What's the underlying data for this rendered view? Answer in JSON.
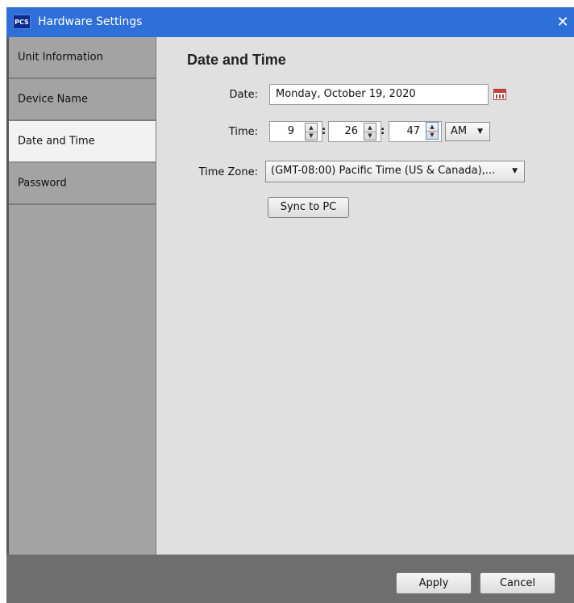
{
  "window": {
    "app_icon_text": "PCS",
    "title": "Hardware Settings",
    "close_glyph": "✕"
  },
  "sidebar": {
    "items": [
      {
        "label": "Unit Information",
        "active": false
      },
      {
        "label": "Device Name",
        "active": false
      },
      {
        "label": "Date and Time",
        "active": true
      },
      {
        "label": "Password",
        "active": false
      }
    ]
  },
  "main": {
    "section_title": "Date and Time",
    "date": {
      "label": "Date:",
      "value": "Monday, October 19, 2020",
      "icon": "calendar-icon"
    },
    "time": {
      "label": "Time:",
      "hour": "9",
      "minute": "26",
      "second": "47",
      "separator": ":",
      "ampm": "AM"
    },
    "timezone": {
      "label": "Time Zone:",
      "value": "(GMT-08:00) Pacific Time (US & Canada),..."
    },
    "sync_button": "Sync to PC"
  },
  "footer": {
    "apply_label": "Apply",
    "cancel_label": "Cancel"
  },
  "colors": {
    "title_bar": "#2e6fd8",
    "sidebar": "#a3a3a3",
    "content": "#e0e0e0",
    "footer": "#6e6e6e"
  }
}
